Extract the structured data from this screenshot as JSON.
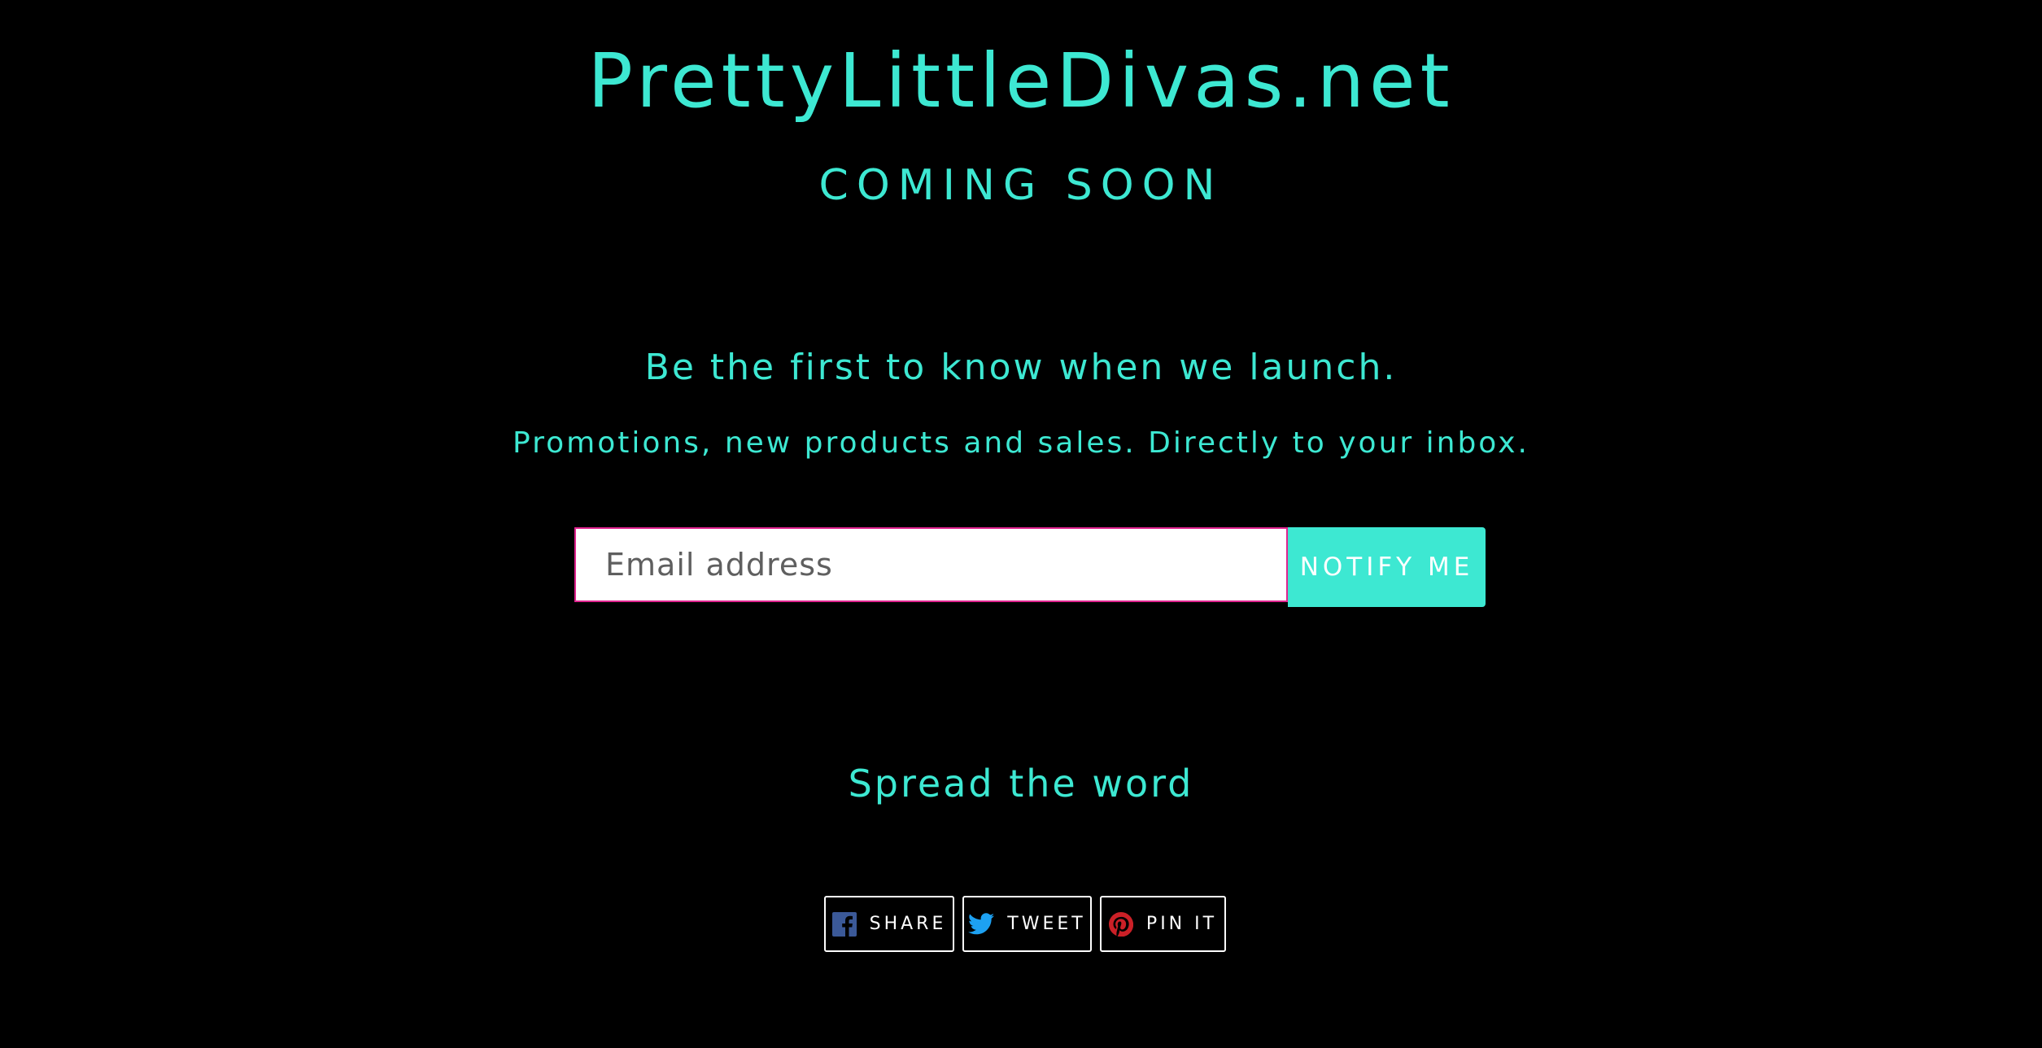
{
  "site": {
    "title": "PrettyLittleDivas.net",
    "status": "COMING SOON"
  },
  "signup": {
    "headline": "Be the first to know when we launch.",
    "description": "Promotions, new products and sales. Directly to your inbox.",
    "email_placeholder": "Email address",
    "email_value": "",
    "submit_label": "NOTIFY ME"
  },
  "social": {
    "heading": "Spread the word",
    "buttons": [
      {
        "label": "SHARE",
        "icon": "facebook-icon",
        "color": "#3b5998"
      },
      {
        "label": "TWEET",
        "icon": "twitter-icon",
        "color": "#1da1f2"
      },
      {
        "label": "PIN IT",
        "icon": "pinterest-icon",
        "color": "#cb2027"
      }
    ]
  },
  "colors": {
    "background": "#000000",
    "accent": "#3de8d2",
    "input_border": "#e0248f"
  }
}
